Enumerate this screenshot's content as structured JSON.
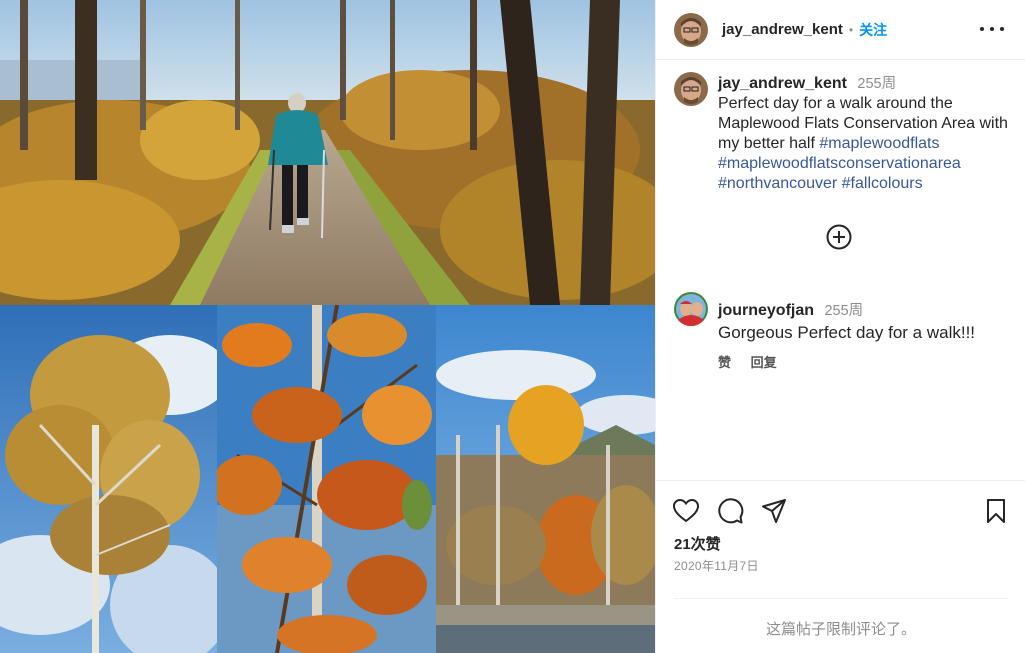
{
  "post": {
    "author": "jay_andrew_kent",
    "separator": "•",
    "follow_label": "关注",
    "more_icon": "more-horizontal-icon"
  },
  "caption": {
    "username": "jay_andrew_kent",
    "time": "255周",
    "text": "Perfect day for a walk around the Maplewood Flats Conservation Area with my better half",
    "hashtags": [
      "#maplewoodflats",
      "#maplewoodflatsconservationarea",
      "#northvancouver",
      "#fallcolours"
    ]
  },
  "load_more_icon": "plus-circle-icon",
  "reply": {
    "username": "journeyofjan",
    "time": "255周",
    "text": "Gorgeous Perfect day for a walk!!!",
    "like_label": "赞",
    "reply_label": "回复"
  },
  "actions": {
    "icons": [
      "heart-icon",
      "comment-icon",
      "share-icon",
      "bookmark-icon"
    ],
    "likes": "21次赞",
    "date": "2020年11月7日"
  },
  "comments_closed": "这篇帖子限制评论了。",
  "colors": {
    "accent": "#0095f6",
    "hashtag": "#385898",
    "muted": "#8e8e8e",
    "text": "#262626"
  }
}
